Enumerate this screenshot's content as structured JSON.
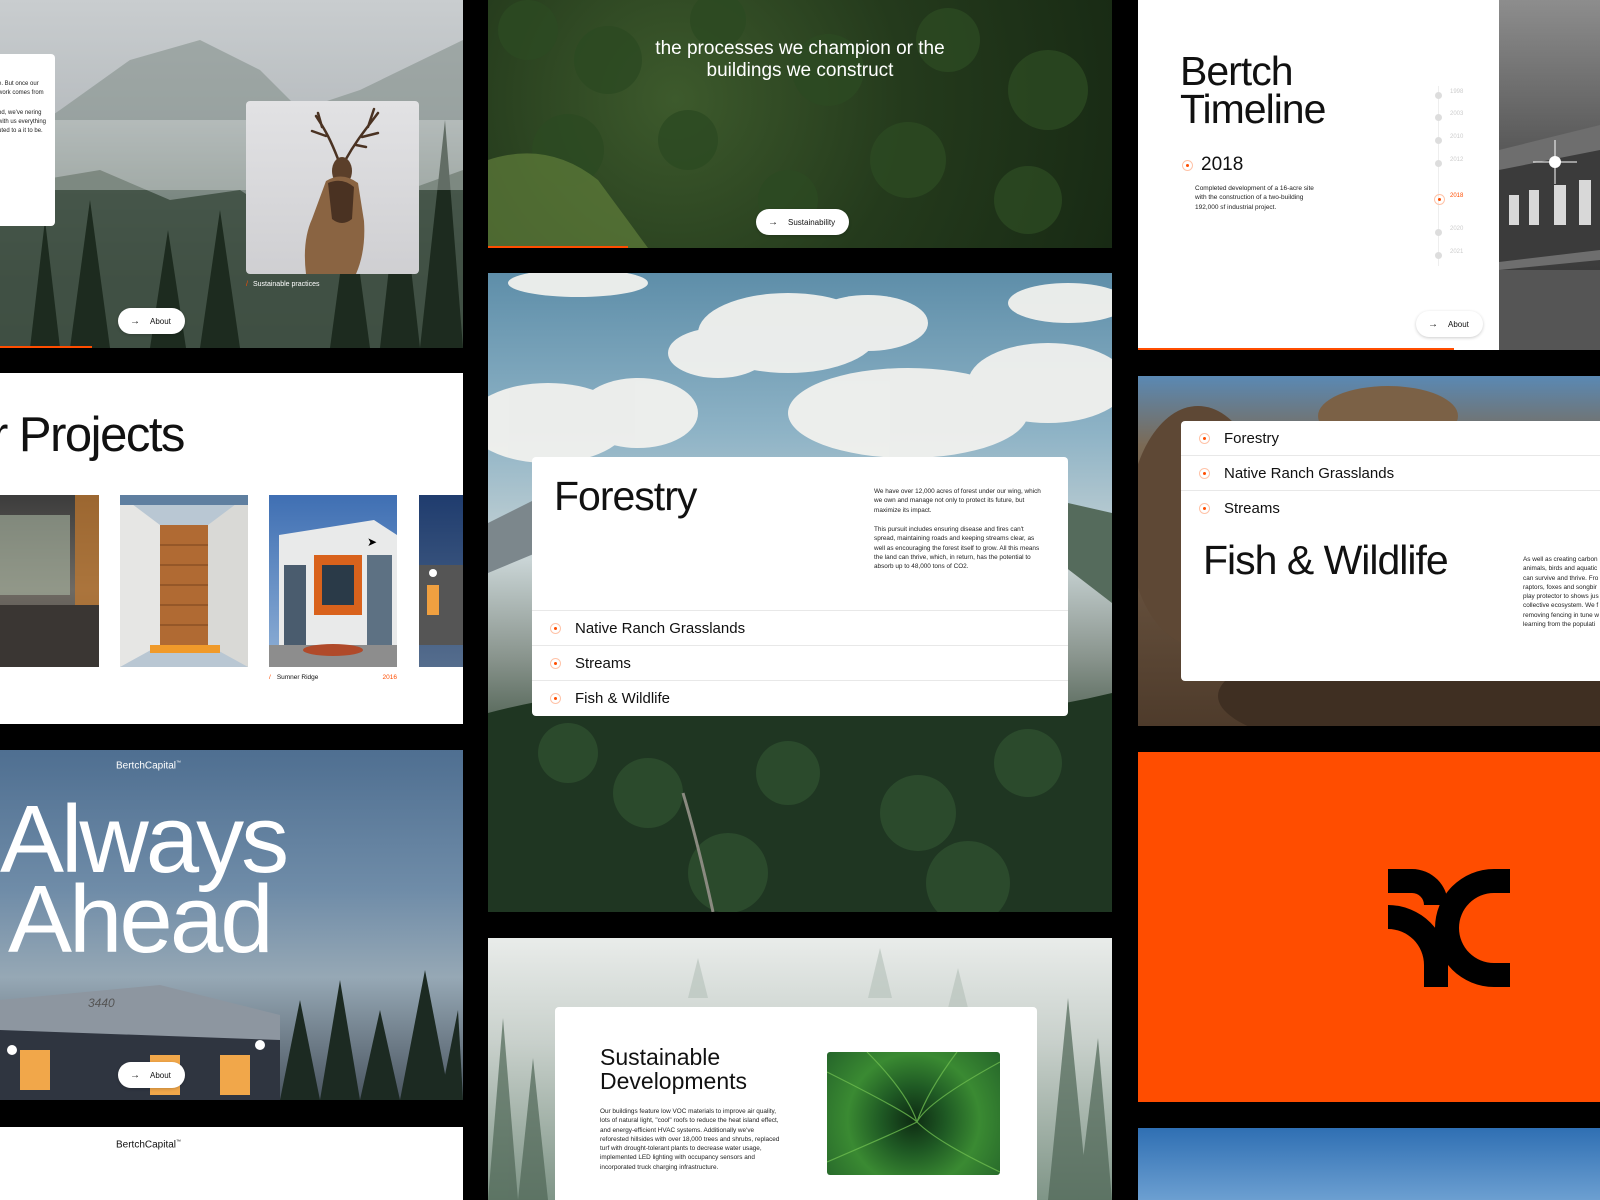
{
  "panels": {
    "elk": {
      "card_text_1": "e. But once our work comes from",
      "card_text_2": "od, we've nering with us everything uted to a it to be.",
      "caption_slash": "/",
      "caption": "Sustainable practices",
      "button_label": "About"
    },
    "forest_top": {
      "headline": "the processes we champion or the buildings we construct",
      "button_label": "Sustainability"
    },
    "timeline": {
      "title": "Bertch Timeline",
      "active_year": "2018",
      "description": "Completed development of a 16-acre site with the construction of a two-building 192,000 sf industrial project.",
      "years": [
        "1998",
        "2003",
        "2010",
        "2012",
        "2018",
        "2020",
        "2021"
      ],
      "active_index": 4,
      "button_label": "About"
    },
    "projects": {
      "title": "r Projects",
      "caption_slash": "/",
      "caption": "Sumner Ridge",
      "caption_year": "2016"
    },
    "forestry": {
      "title": "Forestry",
      "para1": "We have over 12,000 acres of forest under our wing, which we own and manage not only to protect its future, but maximize its impact.",
      "para2": "This pursuit includes ensuring disease and fires can't spread, maintaining roads and keeping streams clear, as well as encouraging the forest itself to grow. All this means the land can thrive, which, in return, has the potential to absorb up to 48,000 tons of CO2.",
      "list": [
        "Native Ranch Grasslands",
        "Streams",
        "Fish & Wildlife"
      ]
    },
    "wildlife": {
      "list": [
        "Forestry",
        "Native Ranch Grasslands",
        "Streams"
      ],
      "title": "Fish & Wildlife",
      "para": "As well as creating carbon animals, birds and aquatic can survive and thrive. Fro raptors, foxes and songbir play protector to shows jus collective ecosystem. We f removing fencing in tune w learning from the populati"
    },
    "always": {
      "brand": "BertchCapital",
      "brand_mark": "™",
      "headline_1": "Always",
      "headline_2": "Ahead",
      "building_number": "3440",
      "button_label": "About"
    },
    "sustainable": {
      "title_1": "Sustainable",
      "title_2": "Developments",
      "para": "Our buildings feature low VOC materials to improve air quality, lots of natural light, \"cool\" roofs to reduce the heat island effect, and energy-efficient HVAC systems. Additionally we've reforested hillsides with over 18,000 trees and shrubs, replaced turf with drought-tolerant plants to decrease water usage, implemented LED lighting with occupancy sensors and incorporated truck charging infrastructure."
    },
    "bottom_brand": {
      "brand": "BertchCapital",
      "brand_mark": "™"
    }
  },
  "icons": {
    "arrow": "arrow-right-icon",
    "cursor": "cursor-icon",
    "logo": "bertch-logo-mark"
  },
  "colors": {
    "accent": "#ff4d00",
    "background": "#000000",
    "card": "#ffffff"
  }
}
